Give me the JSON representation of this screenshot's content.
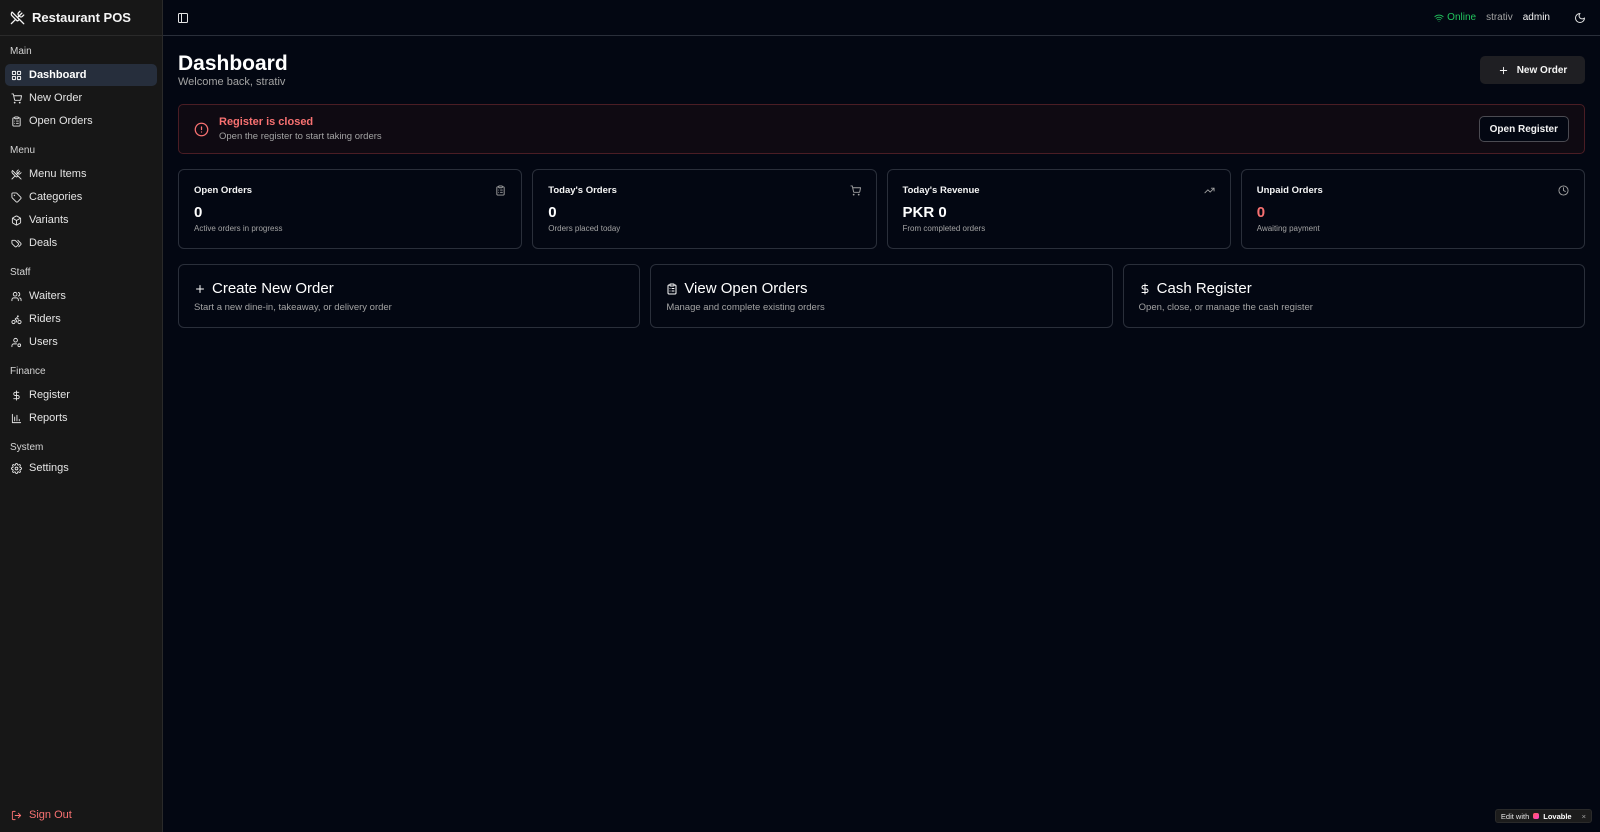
{
  "app": {
    "name": "Restaurant POS"
  },
  "sidebar": {
    "groups": [
      {
        "label": "Main",
        "items": [
          {
            "label": "Dashboard",
            "icon": "layout-grid-icon",
            "active": true
          },
          {
            "label": "New Order",
            "icon": "cart-icon"
          },
          {
            "label": "Open Orders",
            "icon": "clipboard-icon"
          }
        ]
      },
      {
        "label": "Menu",
        "items": [
          {
            "label": "Menu Items",
            "icon": "utensils-icon"
          },
          {
            "label": "Categories",
            "icon": "tag-icon"
          },
          {
            "label": "Variants",
            "icon": "package-icon"
          },
          {
            "label": "Deals",
            "icon": "tags-icon"
          }
        ]
      },
      {
        "label": "Staff",
        "items": [
          {
            "label": "Waiters",
            "icon": "users-icon"
          },
          {
            "label": "Riders",
            "icon": "bike-icon"
          },
          {
            "label": "Users",
            "icon": "user-cog-icon"
          }
        ]
      },
      {
        "label": "Finance",
        "items": [
          {
            "label": "Register",
            "icon": "dollar-icon"
          },
          {
            "label": "Reports",
            "icon": "bar-chart-icon"
          }
        ]
      },
      {
        "label": "System",
        "items": [
          {
            "label": "Settings",
            "icon": "gear-icon"
          }
        ]
      }
    ],
    "sign_out": "Sign Out"
  },
  "header": {
    "status": "Online",
    "username": "strativ",
    "role": "admin",
    "status_color": "#22c55e"
  },
  "page": {
    "title": "Dashboard",
    "subtitle": "Welcome back, strativ",
    "new_order_label": "New Order"
  },
  "alert": {
    "title": "Register is closed",
    "description": "Open the register to start taking orders",
    "button": "Open Register",
    "color": "#f87171"
  },
  "stats": [
    {
      "title": "Open Orders",
      "value": "0",
      "description": "Active orders in progress",
      "icon": "clipboard-icon"
    },
    {
      "title": "Today's Orders",
      "value": "0",
      "description": "Orders placed today",
      "icon": "cart-icon"
    },
    {
      "title": "Today's Revenue",
      "value": "PKR 0",
      "description": "From completed orders",
      "icon": "trending-up-icon"
    },
    {
      "title": "Unpaid Orders",
      "value": "0",
      "description": "Awaiting payment",
      "icon": "clock-icon"
    }
  ],
  "actions": [
    {
      "title": "Create New Order",
      "description": "Start a new dine-in, takeaway, or delivery order",
      "icon": "plus-icon"
    },
    {
      "title": "View Open Orders",
      "description": "Manage and complete existing orders",
      "icon": "clipboard-icon"
    },
    {
      "title": "Cash Register",
      "description": "Open, close, or manage the cash register",
      "icon": "dollar-icon"
    }
  ],
  "badge": {
    "prefix": "Edit with",
    "brand": "Lovable",
    "close": "×"
  }
}
